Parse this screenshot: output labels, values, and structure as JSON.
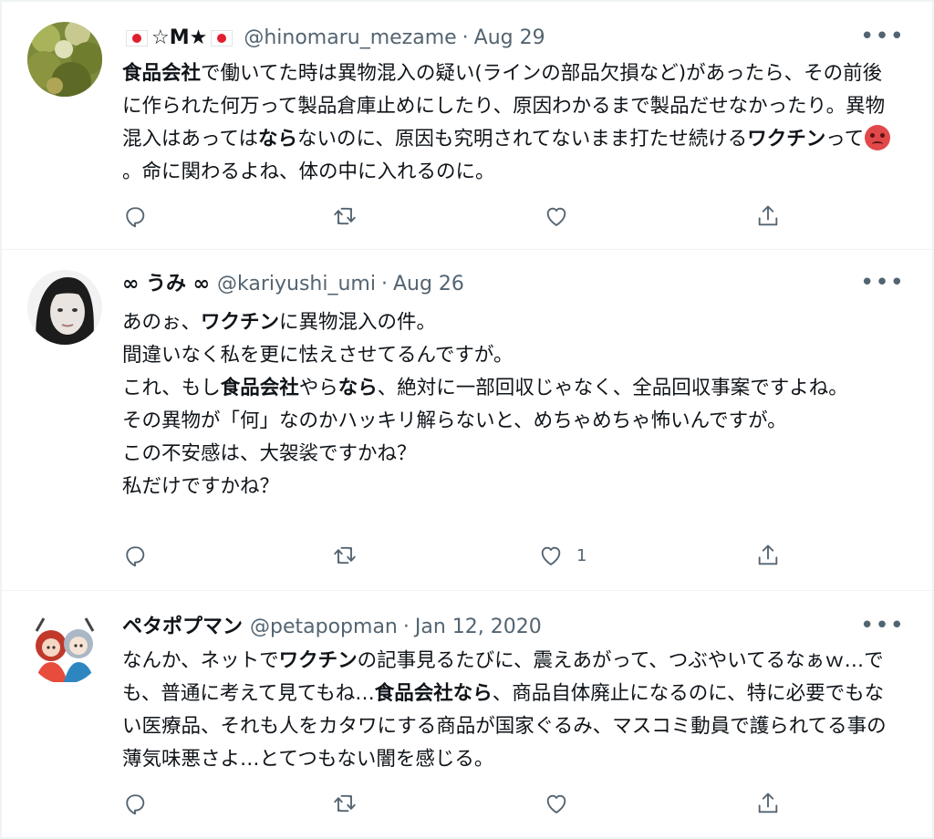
{
  "tweets": [
    {
      "display_name": "☆M★",
      "handle": "@hinomaru_mezame",
      "separator": "·",
      "date": "Aug 29",
      "more": "•••",
      "body": {
        "t1": "食品会社",
        "t2": "で働いてた時は異物混入の疑い(ラインの部品欠損など)があったら、その前後に作られた何万って製品倉庫止めにしたり、原因わかるまで製品だせなかったり。異物混入はあっては",
        "t3": "なら",
        "t4": "ないのに、原因も究明されてないまま打たせ続ける",
        "t5": "ワクチン",
        "t6": "って",
        "t7": "。命に関わるよね、体の中に入れるのに。"
      },
      "counts": {
        "reply": "",
        "retweet": "",
        "like": ""
      },
      "icons": [
        "reply-icon",
        "retweet-icon",
        "like-icon",
        "share-icon"
      ]
    },
    {
      "display_name": "∞ うみ ∞",
      "handle": "@kariyushi_umi",
      "separator": "·",
      "date": "Aug 26",
      "more": "•••",
      "body": {
        "l1a": "あのぉ、",
        "l1b": "ワクチン",
        "l1c": "に異物混入の件。",
        "l2": "間違いなく私を更に怯えさせてるんですが。",
        "l3a": "これ、もし",
        "l3b": "食品会社",
        "l3c": "やら",
        "l3d": "なら",
        "l3e": "、絶対に一部回収じゃなく、全品回収事案ですよね。",
        "l4": "その異物が「何」なのかハッキリ解らないと、めちゃめちゃ怖いんですが。",
        "l5": "この不安感は、大袈裟ですかね？",
        "l6": "私だけですかね？"
      },
      "counts": {
        "reply": "",
        "retweet": "",
        "like": "1"
      },
      "icons": [
        "reply-icon",
        "retweet-icon",
        "like-icon",
        "share-icon"
      ]
    },
    {
      "display_name": "ペタポプマン",
      "handle": "@petapopman",
      "separator": "·",
      "date": "Jan 12, 2020",
      "more": "•••",
      "body": {
        "t1": "なんか、ネットで",
        "t2": "ワクチン",
        "t3": "の記事見るたびに、震えあがって、つぶやいてるなぁｗ…でも、普通に考えて見てもね…",
        "t4": "食品会社なら",
        "t5": "、商品自体廃止になるのに、特に必要でもない医療品、それも人をカタワにする商品が国家ぐるみ、マスコミ動員で護られてる事の薄気味悪さよ…とてつもない闇を感じる。"
      },
      "counts": {
        "reply": "",
        "retweet": "",
        "like": ""
      },
      "icons": [
        "reply-icon",
        "retweet-icon",
        "like-icon",
        "share-icon"
      ]
    }
  ],
  "colors": {
    "text": "#0f1419",
    "muted": "#536471",
    "divider": "#eff3f4",
    "flag_red": "#e0202e",
    "angry_emoji": "#e0484a"
  }
}
